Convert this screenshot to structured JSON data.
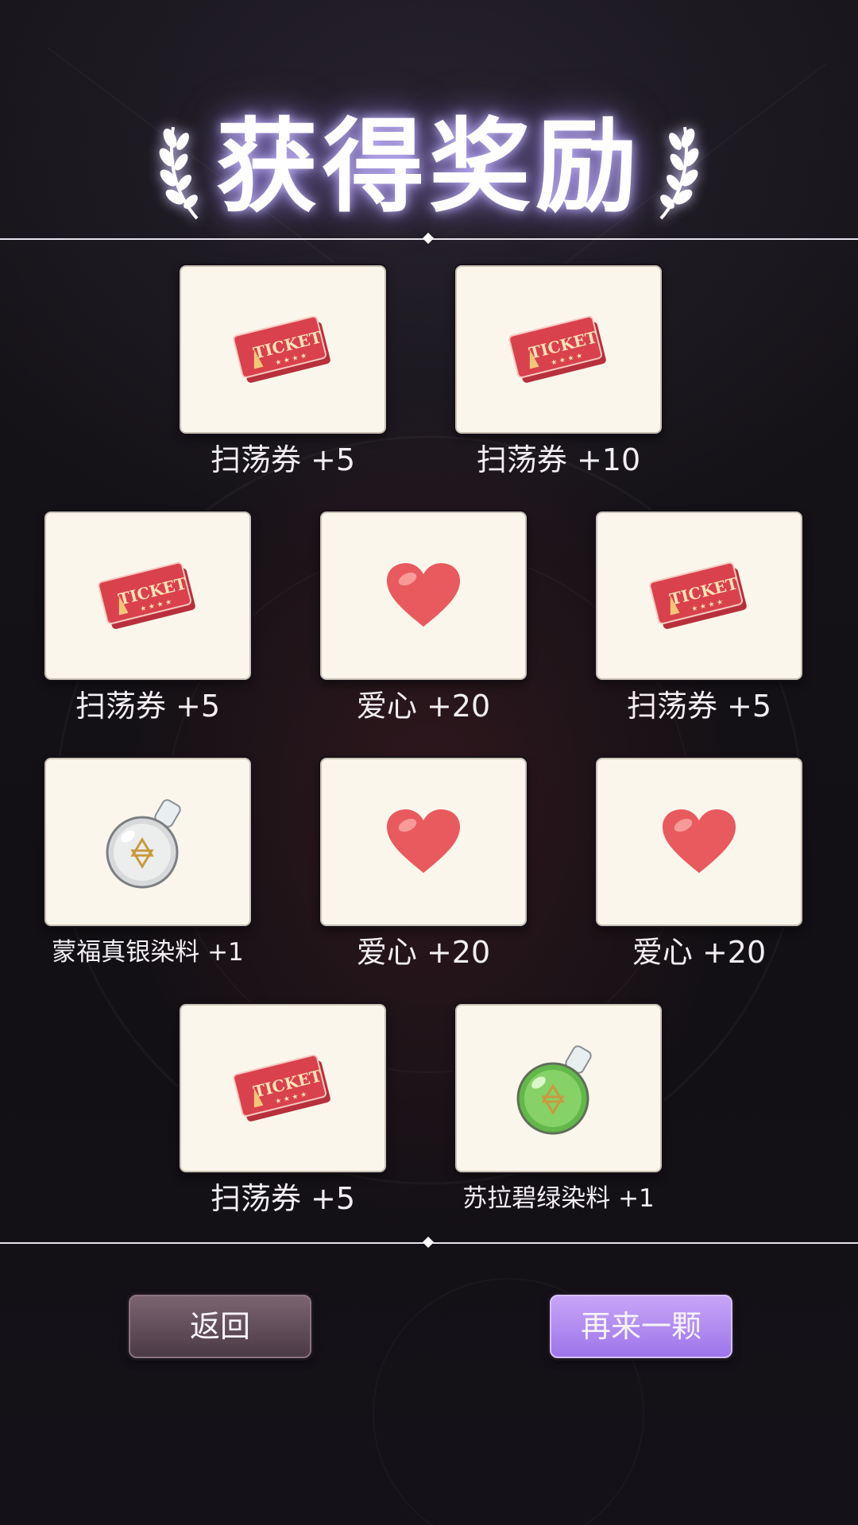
{
  "title": "获得奖励",
  "rewards": [
    {
      "icon": "ticket-icon",
      "label": "扫荡券 +5"
    },
    {
      "icon": "ticket-icon",
      "label": "扫荡券 +10"
    },
    {
      "icon": "ticket-icon",
      "label": "扫荡券 +5"
    },
    {
      "icon": "heart-icon",
      "label": "爱心 +20"
    },
    {
      "icon": "ticket-icon",
      "label": "扫荡券 +5"
    },
    {
      "icon": "silver-dye-bottle-icon",
      "label": "蒙福真银染料 +1"
    },
    {
      "icon": "heart-icon",
      "label": "爱心 +20"
    },
    {
      "icon": "heart-icon",
      "label": "爱心 +20"
    },
    {
      "icon": "ticket-icon",
      "label": "扫荡券 +5"
    },
    {
      "icon": "green-dye-bottle-icon",
      "label": "苏拉碧绿染料 +1"
    }
  ],
  "buttons": {
    "back_label": "返回",
    "again_label": "再来一颗"
  },
  "colors": {
    "accent": "#a98bf0",
    "card_bg": "#fbf6ec",
    "back_button": "#5f4b57"
  }
}
